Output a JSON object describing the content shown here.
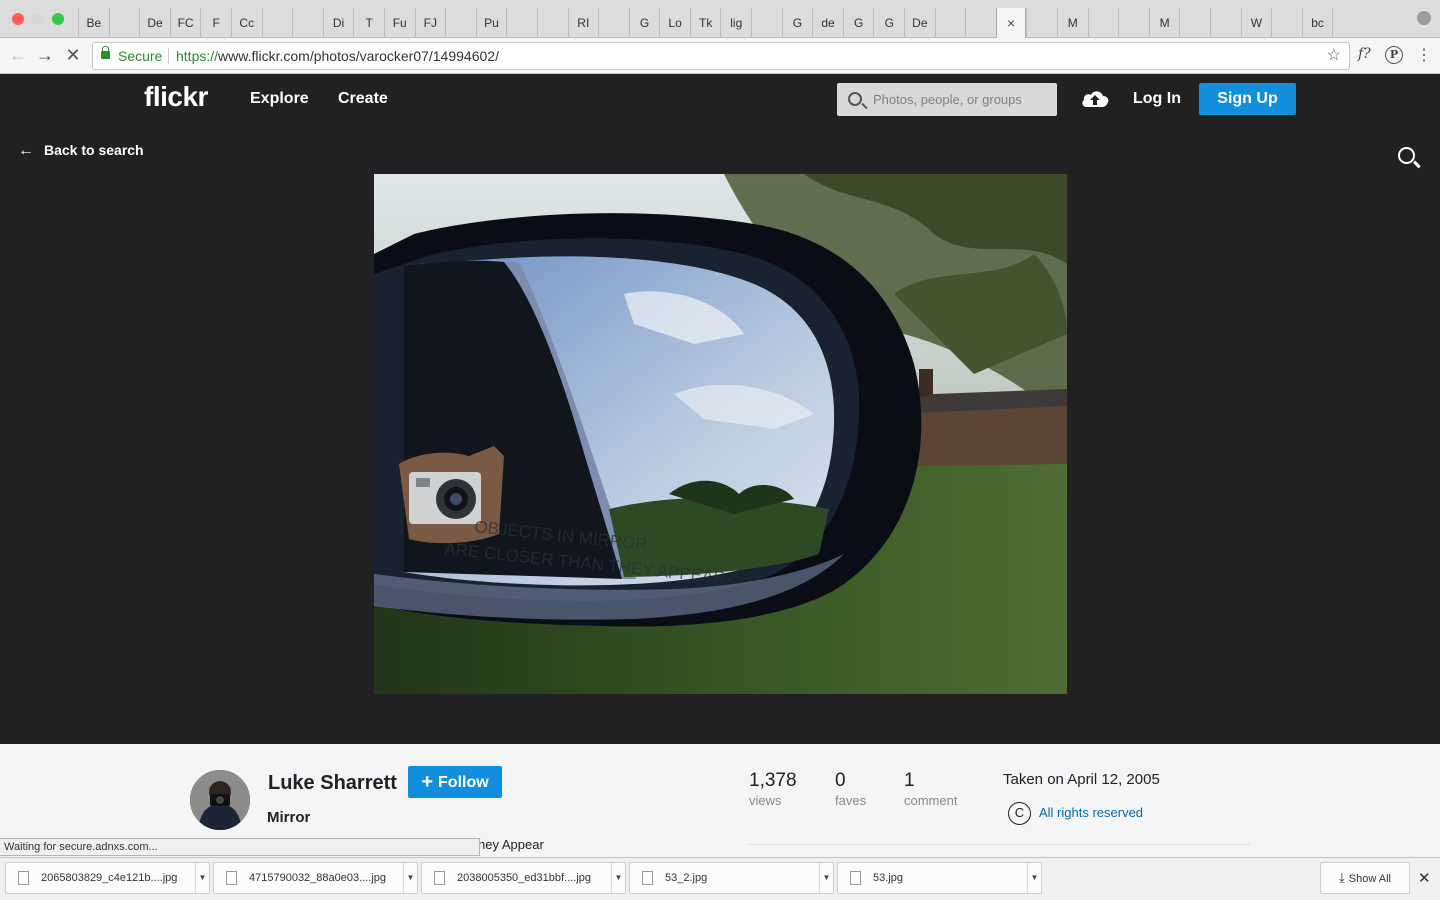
{
  "browser": {
    "tabs": [
      "Be",
      "",
      "De",
      "FC",
      "F",
      "Cc",
      "",
      "",
      "Di",
      "T",
      "Fu",
      "FJ",
      "",
      "Pu",
      "",
      "",
      "RI",
      "",
      "G",
      "Lo",
      "Tk",
      "lig",
      "",
      "G",
      "de",
      "G",
      "G",
      "De",
      "",
      "",
      "×",
      "",
      "M",
      "",
      "",
      "M",
      "",
      "",
      "W",
      "",
      "bc",
      ""
    ],
    "secure_label": "Secure",
    "url_scheme": "https://",
    "url_rest": "www.flickr.com/photos/varocker07/14994602/"
  },
  "flickr_nav": {
    "logo": "flickr",
    "explore": "Explore",
    "create": "Create",
    "search_placeholder": "Photos, people, or groups",
    "login": "Log In",
    "signup": "Sign Up"
  },
  "photo_area": {
    "back_link": "Back to search",
    "mirror_text_line1": "OBJECTS IN MIRROR",
    "mirror_text_line2": "ARE CLOSER THAN THEY APPEAR"
  },
  "info": {
    "author": "Luke Sharrett",
    "follow": "Follow",
    "title": "Mirror",
    "description_visible": "hey Appear",
    "stats": {
      "views_num": "1,378",
      "views_label": "views",
      "faves_num": "0",
      "faves_label": "faves",
      "comments_num": "1",
      "comments_label": "comment"
    },
    "taken": "Taken on April 12, 2005",
    "rights": "All rights reserved",
    "cc_symbol": "C"
  },
  "status_bar": "Waiting for secure.adnxs.com...",
  "downloads": {
    "items": [
      "2065803829_c4e121b....jpg",
      "4715790032_88a0e03....jpg",
      "2038005350_ed31bbf....jpg",
      "53_2.jpg",
      "53.jpg"
    ],
    "show_all": "Show All"
  },
  "colors": {
    "flickr_dark": "#212124",
    "flickr_blue": "#128fdc",
    "link_blue": "#006dac",
    "secure_green": "#2e8b2e"
  }
}
